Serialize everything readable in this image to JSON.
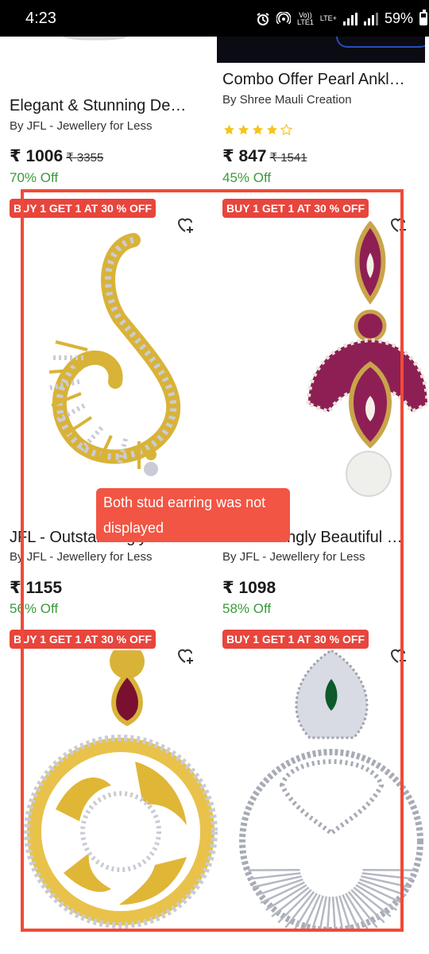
{
  "status": {
    "time": "4:23",
    "network": "LTE+",
    "network_sub": "LTE1",
    "volte": "Vo))",
    "battery": "59%",
    "battery_level": 0.59
  },
  "products": [
    {
      "title": "Elegant & Stunning De…",
      "brand": "By JFL - Jewellery for Less",
      "price": "₹ 1006",
      "old_price": "₹ 3355",
      "off": "70% Off"
    },
    {
      "title": "Combo Offer Pearl Ankl…",
      "brand": "By Shree Mauli Creation",
      "rating": 4,
      "price": "₹ 847",
      "old_price": "₹ 1541",
      "off": "45% Off"
    },
    {
      "badge": "BUY 1 GET 1 AT 30 % OFF",
      "title": "JFL - Outstandingly Stu…",
      "brand": "By JFL - Jewellery for Less",
      "price": "₹ 1155",
      "off": "56% Off"
    },
    {
      "badge": "BUY 1 GET 1 AT 30 % OFF",
      "title": "Astonishingly Beautiful …",
      "brand": "By JFL - Jewellery for Less",
      "price": "₹ 1098",
      "off": "58% Off"
    },
    {
      "badge": "BUY 1 GET 1 AT 30 % OFF"
    },
    {
      "badge": "BUY 1 GET 1 AT 30 % OFF"
    }
  ],
  "annotation": {
    "line1": "Both stud earring was not",
    "line2": "displayed"
  },
  "colors": {
    "badge": "#e8453c",
    "discount": "#3a9a3a",
    "star": "#f5c518",
    "annotation": "#f04a37",
    "gold": "#d9b338",
    "magenta": "#8e1f55"
  },
  "icons": [
    "alarm-icon",
    "hotspot-icon",
    "signal-icon",
    "battery-icon",
    "wishlist-add-icon",
    "star-icon"
  ]
}
